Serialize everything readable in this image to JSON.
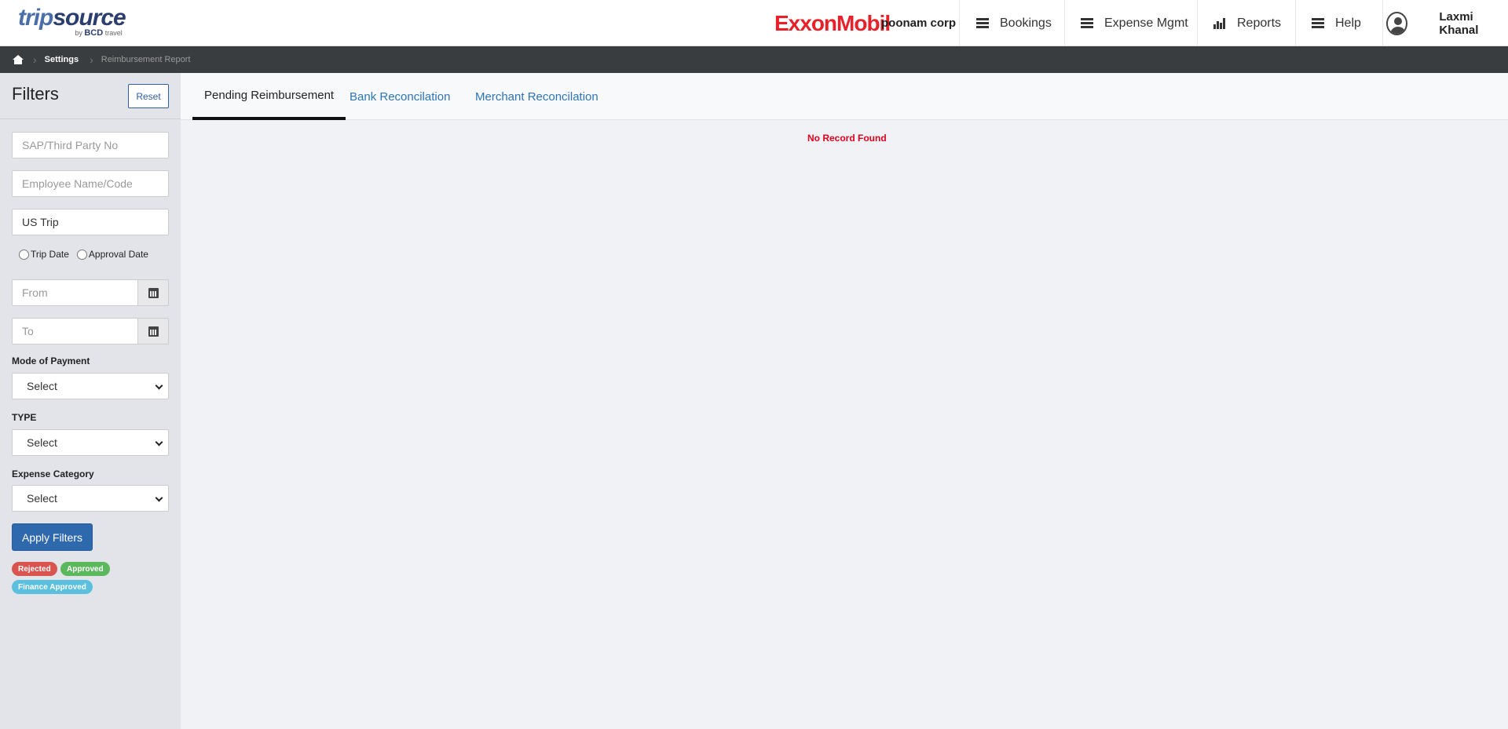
{
  "header": {
    "logo_trip": "trip",
    "logo_source": "source",
    "logo_by": "by",
    "logo_bcd": "BCD",
    "logo_travel": "travel",
    "company_logo": "ExxonMobil",
    "company_name": "poonam corp",
    "nav": [
      {
        "label": "Bookings",
        "icon": "menu-icon"
      },
      {
        "label": "Expense Mgmt",
        "icon": "menu-icon"
      },
      {
        "label": "Reports",
        "icon": "bar-chart-icon"
      },
      {
        "label": "Help",
        "icon": "menu-icon"
      }
    ],
    "user_name": "Laxmi Khanal"
  },
  "breadcrumb": {
    "items": [
      "Settings",
      "Reimbursement Report"
    ]
  },
  "filters": {
    "title": "Filters",
    "reset_label": "Reset",
    "sap_placeholder": "SAP/Third Party No",
    "employee_placeholder": "Employee Name/Code",
    "trip_value": "US  Trip",
    "radio_trip_date": "Trip Date",
    "radio_approval_date": "Approval Date",
    "from_placeholder": "From",
    "to_placeholder": "To",
    "mode_of_payment_label": "Mode of Payment",
    "mode_of_payment_value": "Select",
    "type_label": "TYPE",
    "type_value": "Select",
    "expense_category_label": "Expense Category",
    "expense_category_value": "Select",
    "apply_label": "Apply Filters",
    "badges": [
      {
        "label": "Rejected",
        "color": "#d9534f"
      },
      {
        "label": "Approved",
        "color": "#5cb85c"
      },
      {
        "label": "Finance Approved",
        "color": "#5bc0de"
      }
    ]
  },
  "tabs": [
    {
      "label": "Pending Reimbursement",
      "active": true
    },
    {
      "label": "Bank Reconcilation",
      "active": false
    },
    {
      "label": "Merchant Reconcilation",
      "active": false
    }
  ],
  "main": {
    "empty_message": "No Record Found"
  },
  "colors": {
    "accent": "#2e68ad",
    "brand_red": "#e8202a",
    "link": "#2f75b5",
    "error": "#e0001b"
  }
}
